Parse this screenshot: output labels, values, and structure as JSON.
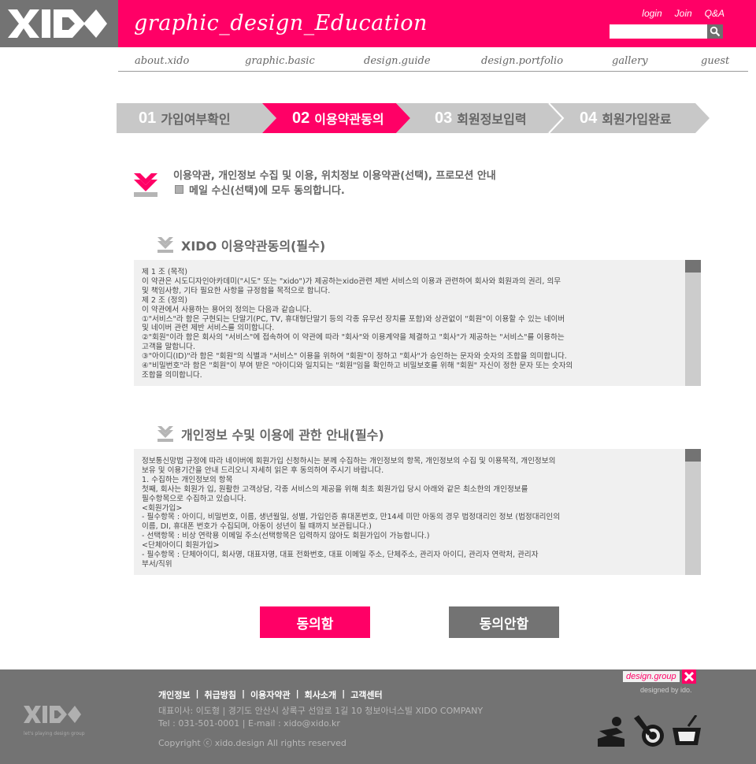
{
  "header": {
    "logo_text": "XIDO",
    "title": "graphic_design_Education",
    "links": [
      "login",
      "Join",
      "Q&A"
    ],
    "search_placeholder": ""
  },
  "nav": {
    "items": [
      "about.xido",
      "graphic.basic",
      "design.guide",
      "design.portfolio",
      "gallery",
      "guest"
    ]
  },
  "steps": [
    {
      "num": "01",
      "label": "가입여부확인",
      "active": false
    },
    {
      "num": "02",
      "label": "이용약관동의",
      "active": true
    },
    {
      "num": "03",
      "label": "회원정보입력",
      "active": false
    },
    {
      "num": "04",
      "label": "회원가입완료",
      "active": false
    }
  ],
  "agree_all": {
    "line1": "이용약관, 개인정보 수집 및 이용, 위치정보 이용약관(선택), 프로모션 안내",
    "line2": "메일 수신(선택)에 모두 동의합니다."
  },
  "terms1": {
    "title": "XIDO 이용약관동의(필수)",
    "text": "제 1 조 (목적)\n이 약관은 시도디자인아카데미(\"시도\" 또는 \"xido\")가 제공하는xido관련 제반 서비스의 이용과 관련하여 회사와 회원과의 권리, 의무\n및 책임사항, 기타 필요한 사항을 규정함을 목적으로 합니다.\n제 2 조 (정의)\n이 약관에서 사용하는 용어의 정의는 다음과 같습니다.\n①\"서비스\"라 함은 구현되는 단말기(PC, TV, 휴대형단말기 등의 각종 유무선 장치를 포함)와 상관없이 \"회원\"이 이용할 수 있는 네이버\n및 네이버 관련 제반 서비스를 의미합니다.\n②\"회원\"이라 함은 회사의 \"서비스\"에 접속하여 이 약관에 따라 \"회사\"와 이용계약을 체결하고 \"회사\"가 제공하는 \"서비스\"를 이용하는\n고객을 말합니다.\n③\"아이디(ID)\"라 함은 \"회원\"의 식별과 \"서비스\" 이용을 위하여 \"회원\"이 정하고 \"회사\"가 승인하는 문자와 숫자의 조합을 의미합니다.\n④\"비밀번호\"라 함은 \"회원\"이 부여 받은 \"아이디와 일치되는 \"회원\"임을 확인하고 비밀보호를 위해 \"회원\" 자신이 정한 문자 또는 숫자의\n조합을 의미합니다."
  },
  "terms2": {
    "title": "개인정보 수및  이용에 관한 안내(필수)",
    "text": "정보통신망법 규정에 따라 네이버에 회원가입 신청하시는 분께 수집하는 개인정보의 항목, 개인정보의 수집 및 이용목적, 개인정보의\n보유 및 이용기간을 안내 드리오니 자세히 읽은 후 동의하여 주시기 바랍니다.\n1. 수집하는 개인정보의 항목\n첫째, 회사는 회원가 입, 원활한 고객상담, 각종 서비스의 제공을 위해 최초 회원가입 당시 아래와 같은 최소한의 개인정보를\n필수항목으로 수집하고 있습니다.\n<회원가입>\n- 필수항목 : 아이디, 비밀번호, 이름, 생년월일, 성별, 가입인증 휴대폰번호, 만14세 미만 아동의 경우 법정대리인 정보 (법정대리인의\n이름, DI, 휴대폰 번호가 수집되며, 아동이 성년이 될 때까지 보관됩니다.)\n- 선택항목 : 비상 연락용 이메일 주소(선택항목은 입력하지 않아도 회원가입이 가능합니다.)\n<단체아이디 회원가입>\n- 필수항목 : 단체아이디, 회사명, 대표자명, 대표 전화번호, 대표 이메일 주소, 단체주소, 관리자 아이디, 관리자 연락처, 관리자\n부서/직위"
  },
  "buttons": {
    "agree": "동의함",
    "disagree": "동의안함"
  },
  "footer": {
    "logo_text": "XIDO",
    "logo_tagline": "let's playing design group",
    "links": [
      "개인정보",
      "취급방침",
      "이용자약관",
      "회사소개",
      "고객센터"
    ],
    "address": "대표이사: 이도형 | 경기도 안산시 상록구 선암로 1길 10 청보아너스빌 XIDO COMPANY",
    "contact": "Tel : 031-501-0001  |  E-mail : xido@xido.kr",
    "copyright": "Copyright ⓒ xido.design All rights reserved",
    "design_group": "design.group",
    "designed_by": "designed by ido."
  },
  "colors": {
    "brand_pink": "#ff0066",
    "dark_gray": "#737373",
    "step_inactive": "#c8c8c8"
  }
}
